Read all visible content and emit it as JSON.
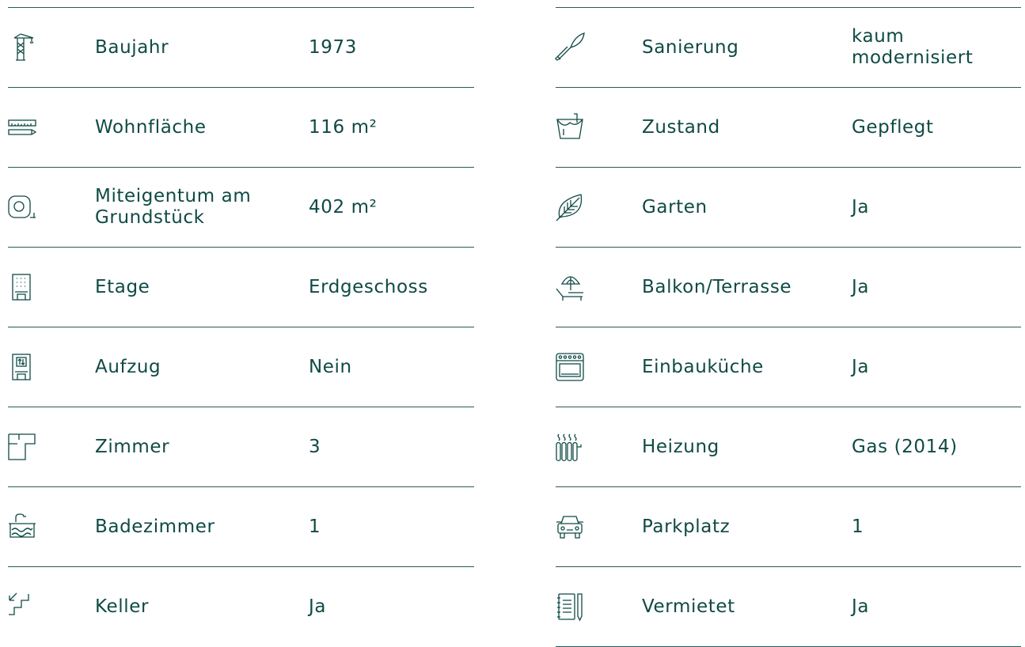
{
  "left": [
    {
      "icon": "crane-icon",
      "label": "Baujahr",
      "value": "1973"
    },
    {
      "icon": "ruler-pencil-icon",
      "label": "Wohnfläche",
      "value": "116 m²"
    },
    {
      "icon": "measuring-tape-icon",
      "label": "Miteigentum am Grundstück",
      "value": "402 m²"
    },
    {
      "icon": "building-icon",
      "label": "Etage",
      "value": "Erdgeschoss"
    },
    {
      "icon": "elevator-icon",
      "label": "Aufzug",
      "value": "Nein"
    },
    {
      "icon": "floorplan-icon",
      "label": "Zimmer",
      "value": "3"
    },
    {
      "icon": "bathtub-icon",
      "label": "Badezimmer",
      "value": "1"
    },
    {
      "icon": "stairs-down-icon",
      "label": "Keller",
      "value": "Ja"
    }
  ],
  "right": [
    {
      "icon": "trowel-icon",
      "label": "Sanierung",
      "value": "kaum modernisiert"
    },
    {
      "icon": "paint-bucket-icon",
      "label": "Zustand",
      "value": "Gepflegt"
    },
    {
      "icon": "leaf-icon",
      "label": "Garten",
      "value": "Ja"
    },
    {
      "icon": "sunbed-umbrella-icon",
      "label": "Balkon/Terrasse",
      "value": "Ja"
    },
    {
      "icon": "stove-icon",
      "label": "Einbauküche",
      "value": "Ja"
    },
    {
      "icon": "radiator-icon",
      "label": "Heizung",
      "value": "Gas (2014)"
    },
    {
      "icon": "car-icon",
      "label": "Parkplatz",
      "value": "1"
    },
    {
      "icon": "notebook-icon",
      "label": "Vermietet",
      "value": "Ja"
    }
  ],
  "colors": {
    "text": "#0f4a45",
    "divider": "#2a5a55",
    "background": "#ffffff"
  }
}
